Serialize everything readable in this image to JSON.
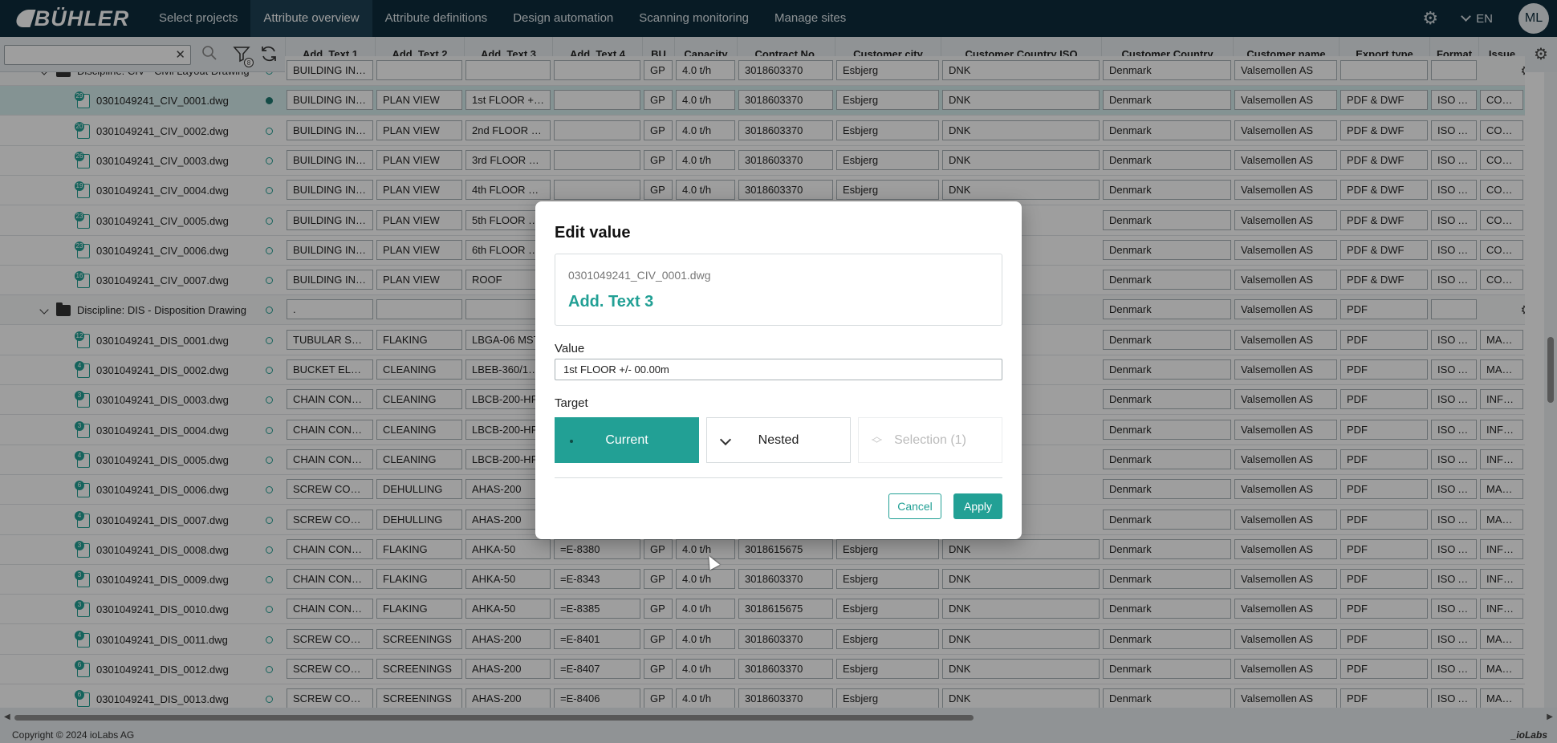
{
  "app": {
    "brand": "BÜHLER"
  },
  "nav": {
    "items": [
      "Select projects",
      "Attribute overview",
      "Attribute definitions",
      "Design automation",
      "Scanning monitoring",
      "Manage sites"
    ],
    "active": 1,
    "language": "EN",
    "user_initials": "ML"
  },
  "toolbar": {
    "search_value": "",
    "filter_count": "8"
  },
  "columns": [
    "Add. Text 1",
    "Add. Text 2",
    "Add. Text 3",
    "Add. Text 4",
    "BU",
    "Capacity",
    "Contract No.",
    "Customer city",
    "Customer Country ISO",
    "Customer Country",
    "Customer name",
    "Export type",
    "Format",
    "Issue"
  ],
  "rows": [
    {
      "type": "group",
      "label": "Discipline: CIV - Civil Layout Drawing",
      "cells": [
        "BUILDING INDI...",
        "",
        "",
        "",
        "GP",
        "4.0 t/h",
        "3018603370",
        "Esbjerg",
        "DNK",
        "Denmark",
        "Valsemollen AS",
        "",
        ""
      ]
    },
    {
      "type": "file",
      "label": "0301049241_CIV_0001.dwg",
      "badge": "29",
      "selected": true,
      "cells": [
        "BUILDING INDI...",
        "PLAN VIEW",
        "1st FLOOR +/- ...",
        "",
        "GP",
        "4.0 t/h",
        "3018603370",
        "Esbjerg",
        "DNK",
        "Denmark",
        "Valsemollen AS",
        "PDF & DWF",
        "ISO A0",
        "CONST"
      ]
    },
    {
      "type": "file",
      "label": "0301049241_CIV_0002.dwg",
      "badge": "20",
      "cells": [
        "BUILDING INDI...",
        "PLAN VIEW",
        "2nd FLOOR +0...",
        "",
        "GP",
        "4.0 t/h",
        "3018603370",
        "Esbjerg",
        "DNK",
        "Denmark",
        "Valsemollen AS",
        "PDF & DWF",
        "ISO A0",
        "CONST"
      ]
    },
    {
      "type": "file",
      "label": "0301049241_CIV_0003.dwg",
      "badge": "26",
      "cells": [
        "BUILDING INDI...",
        "PLAN VIEW",
        "3rd FLOOR +0...",
        "",
        "GP",
        "4.0 t/h",
        "3018603370",
        "Esbjerg",
        "DNK",
        "Denmark",
        "Valsemollen AS",
        "PDF & DWF",
        "ISO A0",
        "CONST"
      ]
    },
    {
      "type": "file",
      "label": "0301049241_CIV_0004.dwg",
      "badge": "19",
      "cells": [
        "BUILDING INDI...",
        "PLAN VIEW",
        "4th FLOOR +1...",
        "",
        "GP",
        "4.0 t/h",
        "3018603370",
        "Esbjerg",
        "DNK",
        "Denmark",
        "Valsemollen AS",
        "PDF & DWF",
        "ISO A0",
        "CONST"
      ]
    },
    {
      "type": "file",
      "label": "0301049241_CIV_0005.dwg",
      "badge": "23",
      "cells": [
        "BUILDING INDI...",
        "PLAN VIEW",
        "5th FLOOR +1...",
        "",
        "",
        "",
        "",
        "",
        "",
        "Denmark",
        "Valsemollen AS",
        "PDF & DWF",
        "ISO A0",
        "CONST"
      ]
    },
    {
      "type": "file",
      "label": "0301049241_CIV_0006.dwg",
      "badge": "23",
      "cells": [
        "BUILDING INDI...",
        "PLAN VIEW",
        "6th FLOOR +1...",
        "",
        "",
        "",
        "",
        "",
        "",
        "Denmark",
        "Valsemollen AS",
        "PDF & DWF",
        "ISO A0",
        "CONST"
      ]
    },
    {
      "type": "file",
      "label": "0301049241_CIV_0007.dwg",
      "badge": "16",
      "cells": [
        "BUILDING INDI...",
        "PLAN VIEW",
        "ROOF",
        "",
        "",
        "",
        "",
        "",
        "",
        "Denmark",
        "Valsemollen AS",
        "PDF & DWF",
        "ISO A0",
        "CONST"
      ]
    },
    {
      "type": "group",
      "label": "Discipline: DIS - Disposition Drawing",
      "cells": [
        ".",
        "",
        "",
        "",
        "",
        "",
        "",
        "",
        "",
        "Denmark",
        "Valsemollen AS",
        "PDF",
        ""
      ]
    },
    {
      "type": "file",
      "label": "0301049241_DIS_0001.dwg",
      "badge": "12",
      "cells": [
        "TUBULAR SCRE...",
        "FLAKING",
        "LBGA-06 MST",
        "",
        "",
        "",
        "",
        "",
        "",
        "Denmark",
        "Valsemollen AS",
        "PDF",
        "ISO A0",
        "MANU"
      ]
    },
    {
      "type": "file",
      "label": "0301049241_DIS_0002.dwg",
      "badge": "4",
      "cells": [
        "BUCKET ELEVA...",
        "CLEANING",
        "LBEB-360/170 ...",
        "",
        "",
        "",
        "",
        "",
        "",
        "Denmark",
        "Valsemollen AS",
        "PDF",
        "ISO A1",
        "MANU"
      ]
    },
    {
      "type": "file",
      "label": "0301049241_DIS_0003.dwg",
      "badge": "3",
      "cells": [
        "CHAIN CONVE...",
        "CLEANING",
        "LBCB-200-HP",
        "",
        "",
        "",
        "",
        "",
        "",
        "Denmark",
        "Valsemollen AS",
        "PDF",
        "ISO A1",
        "INFOR"
      ]
    },
    {
      "type": "file",
      "label": "0301049241_DIS_0004.dwg",
      "badge": "3",
      "cells": [
        "CHAIN CONVE...",
        "CLEANING",
        "LBCB-200-HP",
        "",
        "",
        "",
        "",
        "",
        "",
        "Denmark",
        "Valsemollen AS",
        "PDF",
        "ISO A1",
        "INFOR"
      ]
    },
    {
      "type": "file",
      "label": "0301049241_DIS_0005.dwg",
      "badge": "4",
      "cells": [
        "CHAIN CONVE...",
        "CLEANING",
        "LBCB-200-HP",
        "",
        "",
        "",
        "",
        "",
        "",
        "Denmark",
        "Valsemollen AS",
        "PDF",
        "ISO A1",
        "INFOR"
      ]
    },
    {
      "type": "file",
      "label": "0301049241_DIS_0006.dwg",
      "badge": "6",
      "cells": [
        "SCREW CONVE...",
        "DEHULLING",
        "AHAS-200",
        "",
        "",
        "",
        "",
        "",
        "",
        "Denmark",
        "Valsemollen AS",
        "PDF",
        "ISO A1",
        "MANU"
      ]
    },
    {
      "type": "file",
      "label": "0301049241_DIS_0007.dwg",
      "badge": "4",
      "cells": [
        "SCREW CONVE...",
        "DEHULLING",
        "AHAS-200",
        "",
        "",
        "",
        "",
        "",
        "",
        "Denmark",
        "Valsemollen AS",
        "PDF",
        "ISO A1",
        "MANU"
      ]
    },
    {
      "type": "file",
      "label": "0301049241_DIS_0008.dwg",
      "badge": "3",
      "cells": [
        "CHAIN CONVE...",
        "FLAKING",
        "AHKA-50",
        "=E-8380",
        "GP",
        "4.0 t/h",
        "3018615675",
        "Esbjerg",
        "DNK",
        "Denmark",
        "Valsemollen AS",
        "PDF",
        "ISO A1",
        "INFOR"
      ]
    },
    {
      "type": "file",
      "label": "0301049241_DIS_0009.dwg",
      "badge": "3",
      "cells": [
        "CHAIN CONVE...",
        "FLAKING",
        "AHKA-50",
        "=E-8343",
        "GP",
        "4.0 t/h",
        "3018603370",
        "Esbjerg",
        "DNK",
        "Denmark",
        "Valsemollen AS",
        "PDF",
        "ISO A1",
        "INFOR"
      ]
    },
    {
      "type": "file",
      "label": "0301049241_DIS_0010.dwg",
      "badge": "3",
      "cells": [
        "CHAIN CONVE...",
        "FLAKING",
        "AHKA-50",
        "=E-8385",
        "GP",
        "4.0 t/h",
        "3018615675",
        "Esbjerg",
        "DNK",
        "Denmark",
        "Valsemollen AS",
        "PDF",
        "ISO A1",
        "INFOR"
      ]
    },
    {
      "type": "file",
      "label": "0301049241_DIS_0011.dwg",
      "badge": "4",
      "cells": [
        "SCREW CONVE...",
        "SCREENINGS",
        "AHAS-200",
        "=E-8401",
        "GP",
        "4.0 t/h",
        "3018603370",
        "Esbjerg",
        "DNK",
        "Denmark",
        "Valsemollen AS",
        "PDF",
        "ISO A1",
        "MANU"
      ]
    },
    {
      "type": "file",
      "label": "0301049241_DIS_0012.dwg",
      "badge": "6",
      "cells": [
        "SCREW CONVE...",
        "SCREENINGS",
        "AHAS-200",
        "=E-8407",
        "GP",
        "4.0 t/h",
        "3018603370",
        "Esbjerg",
        "DNK",
        "Denmark",
        "Valsemollen AS",
        "PDF",
        "ISO A1",
        "MANU"
      ]
    },
    {
      "type": "file",
      "label": "0301049241_DIS_0013.dwg",
      "badge": "6",
      "cells": [
        "SCREW CONVE...",
        "SCREENINGS",
        "AHAS-200",
        "=E-8406",
        "GP",
        "4.0 t/h",
        "3018603370",
        "Esbjerg",
        "DNK",
        "Denmark",
        "Valsemollen AS",
        "PDF",
        "ISO A1",
        "MANU"
      ]
    }
  ],
  "modal": {
    "title": "Edit value",
    "file": "0301049241_CIV_0001.dwg",
    "attribute": "Add. Text 3",
    "value_label": "Value",
    "value": "1st FLOOR +/- 00.00m",
    "target_label": "Target",
    "targets": {
      "current": "Current",
      "nested": "Nested",
      "selection": "Selection (1)"
    },
    "cancel": "Cancel",
    "apply": "Apply"
  },
  "footer": {
    "copyright": "Copyright © 2024 ioLabs AG",
    "brand": "_ioLabs"
  },
  "colors": {
    "accent": "#22a095",
    "nav_bg": "#0d2c3c"
  }
}
